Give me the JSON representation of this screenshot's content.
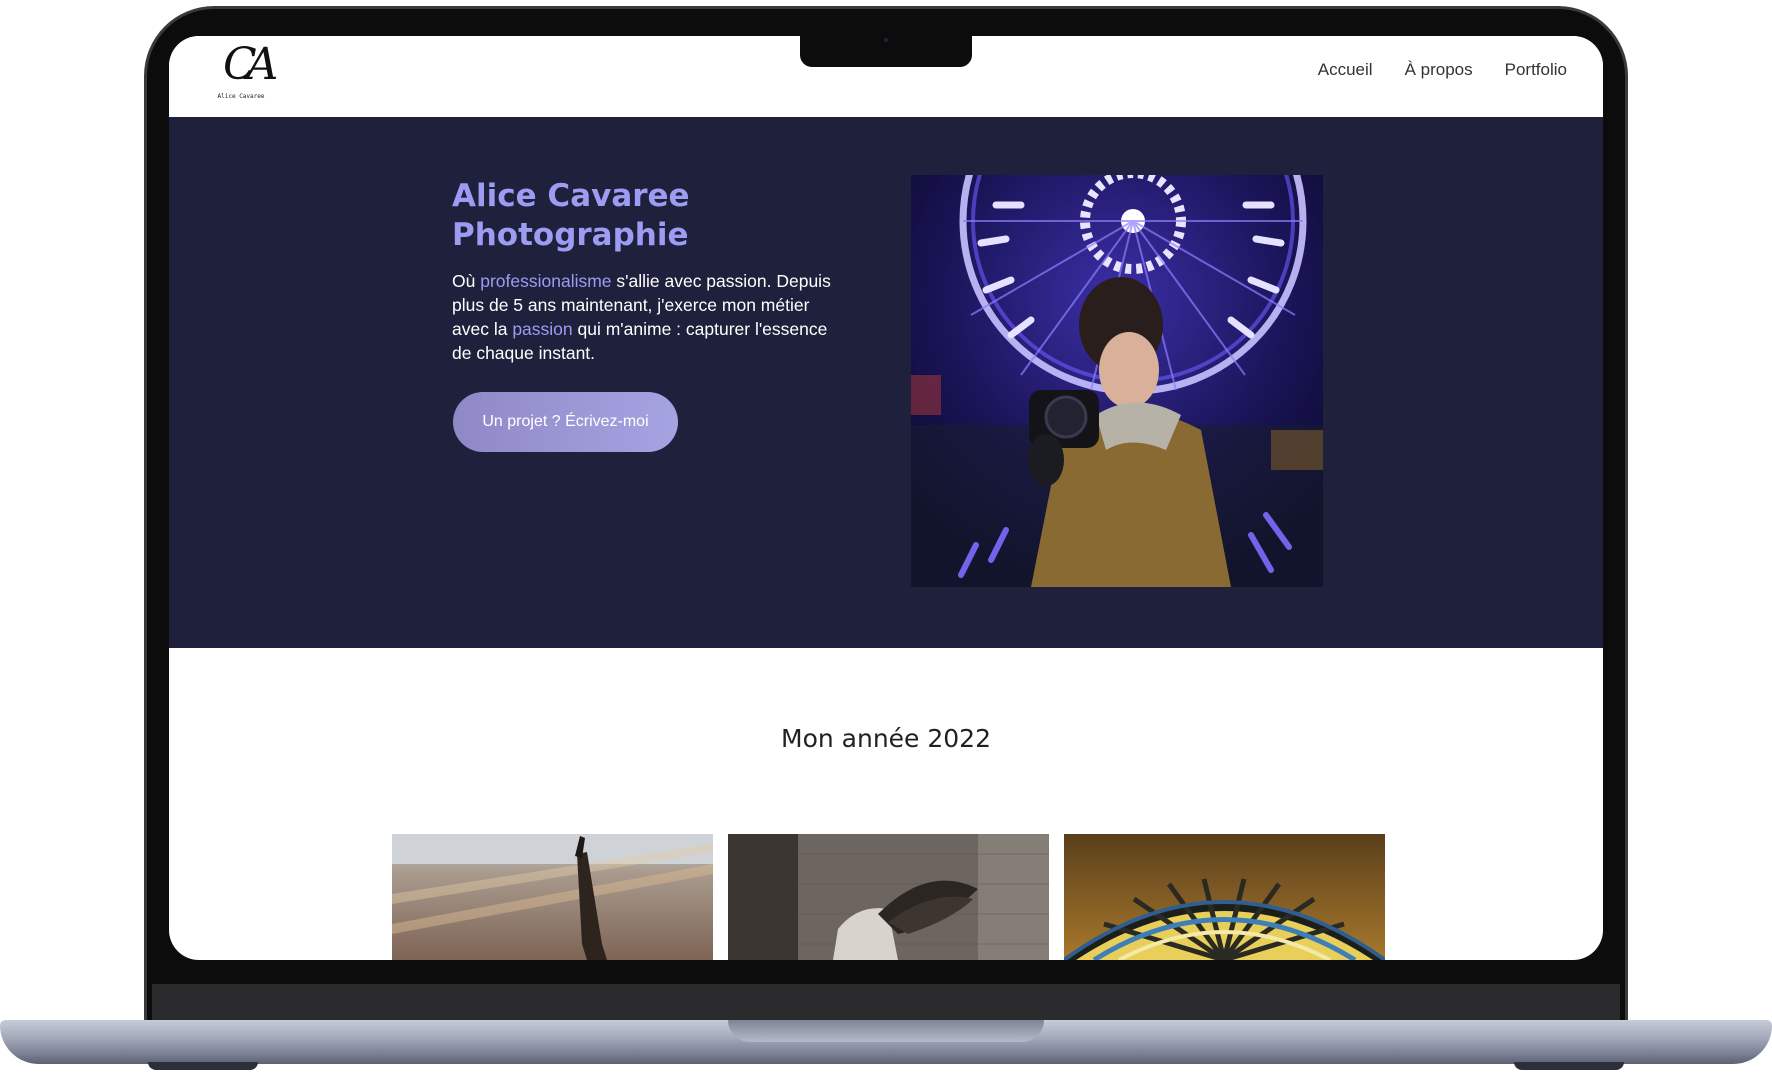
{
  "header": {
    "logo": {
      "mark": "CA",
      "name": "Alice Cavaree"
    },
    "nav": [
      {
        "label": "Accueil"
      },
      {
        "label": "À propos"
      },
      {
        "label": "Portfolio"
      }
    ]
  },
  "hero": {
    "title_line1": "Alice Cavaree",
    "title_line2": "Photographie",
    "paragraph": {
      "part1": "Où ",
      "accent1": "professionalisme",
      "part2": " s'allie avec passion. Depuis plus de 5 ans maintenant, j'exerce mon métier avec la ",
      "accent2": "passion",
      "part3": " qui m'anime : capturer l'essence de chaque instant."
    },
    "cta_label": "Un projet ? Écrivez-moi",
    "photo_description_icon": "photographer-ferris-wheel-photo"
  },
  "gallery": {
    "title": "Mon année 2022",
    "items": [
      {
        "icon": "sculpture-hand-photo"
      },
      {
        "icon": "winged-statue-photo"
      },
      {
        "icon": "stained-glass-photo"
      }
    ]
  },
  "colors": {
    "hero_bg": "#1e203c",
    "accent": "#9d9cf3",
    "cta_start": "#8f88c6",
    "cta_end": "#a6a3e2"
  }
}
